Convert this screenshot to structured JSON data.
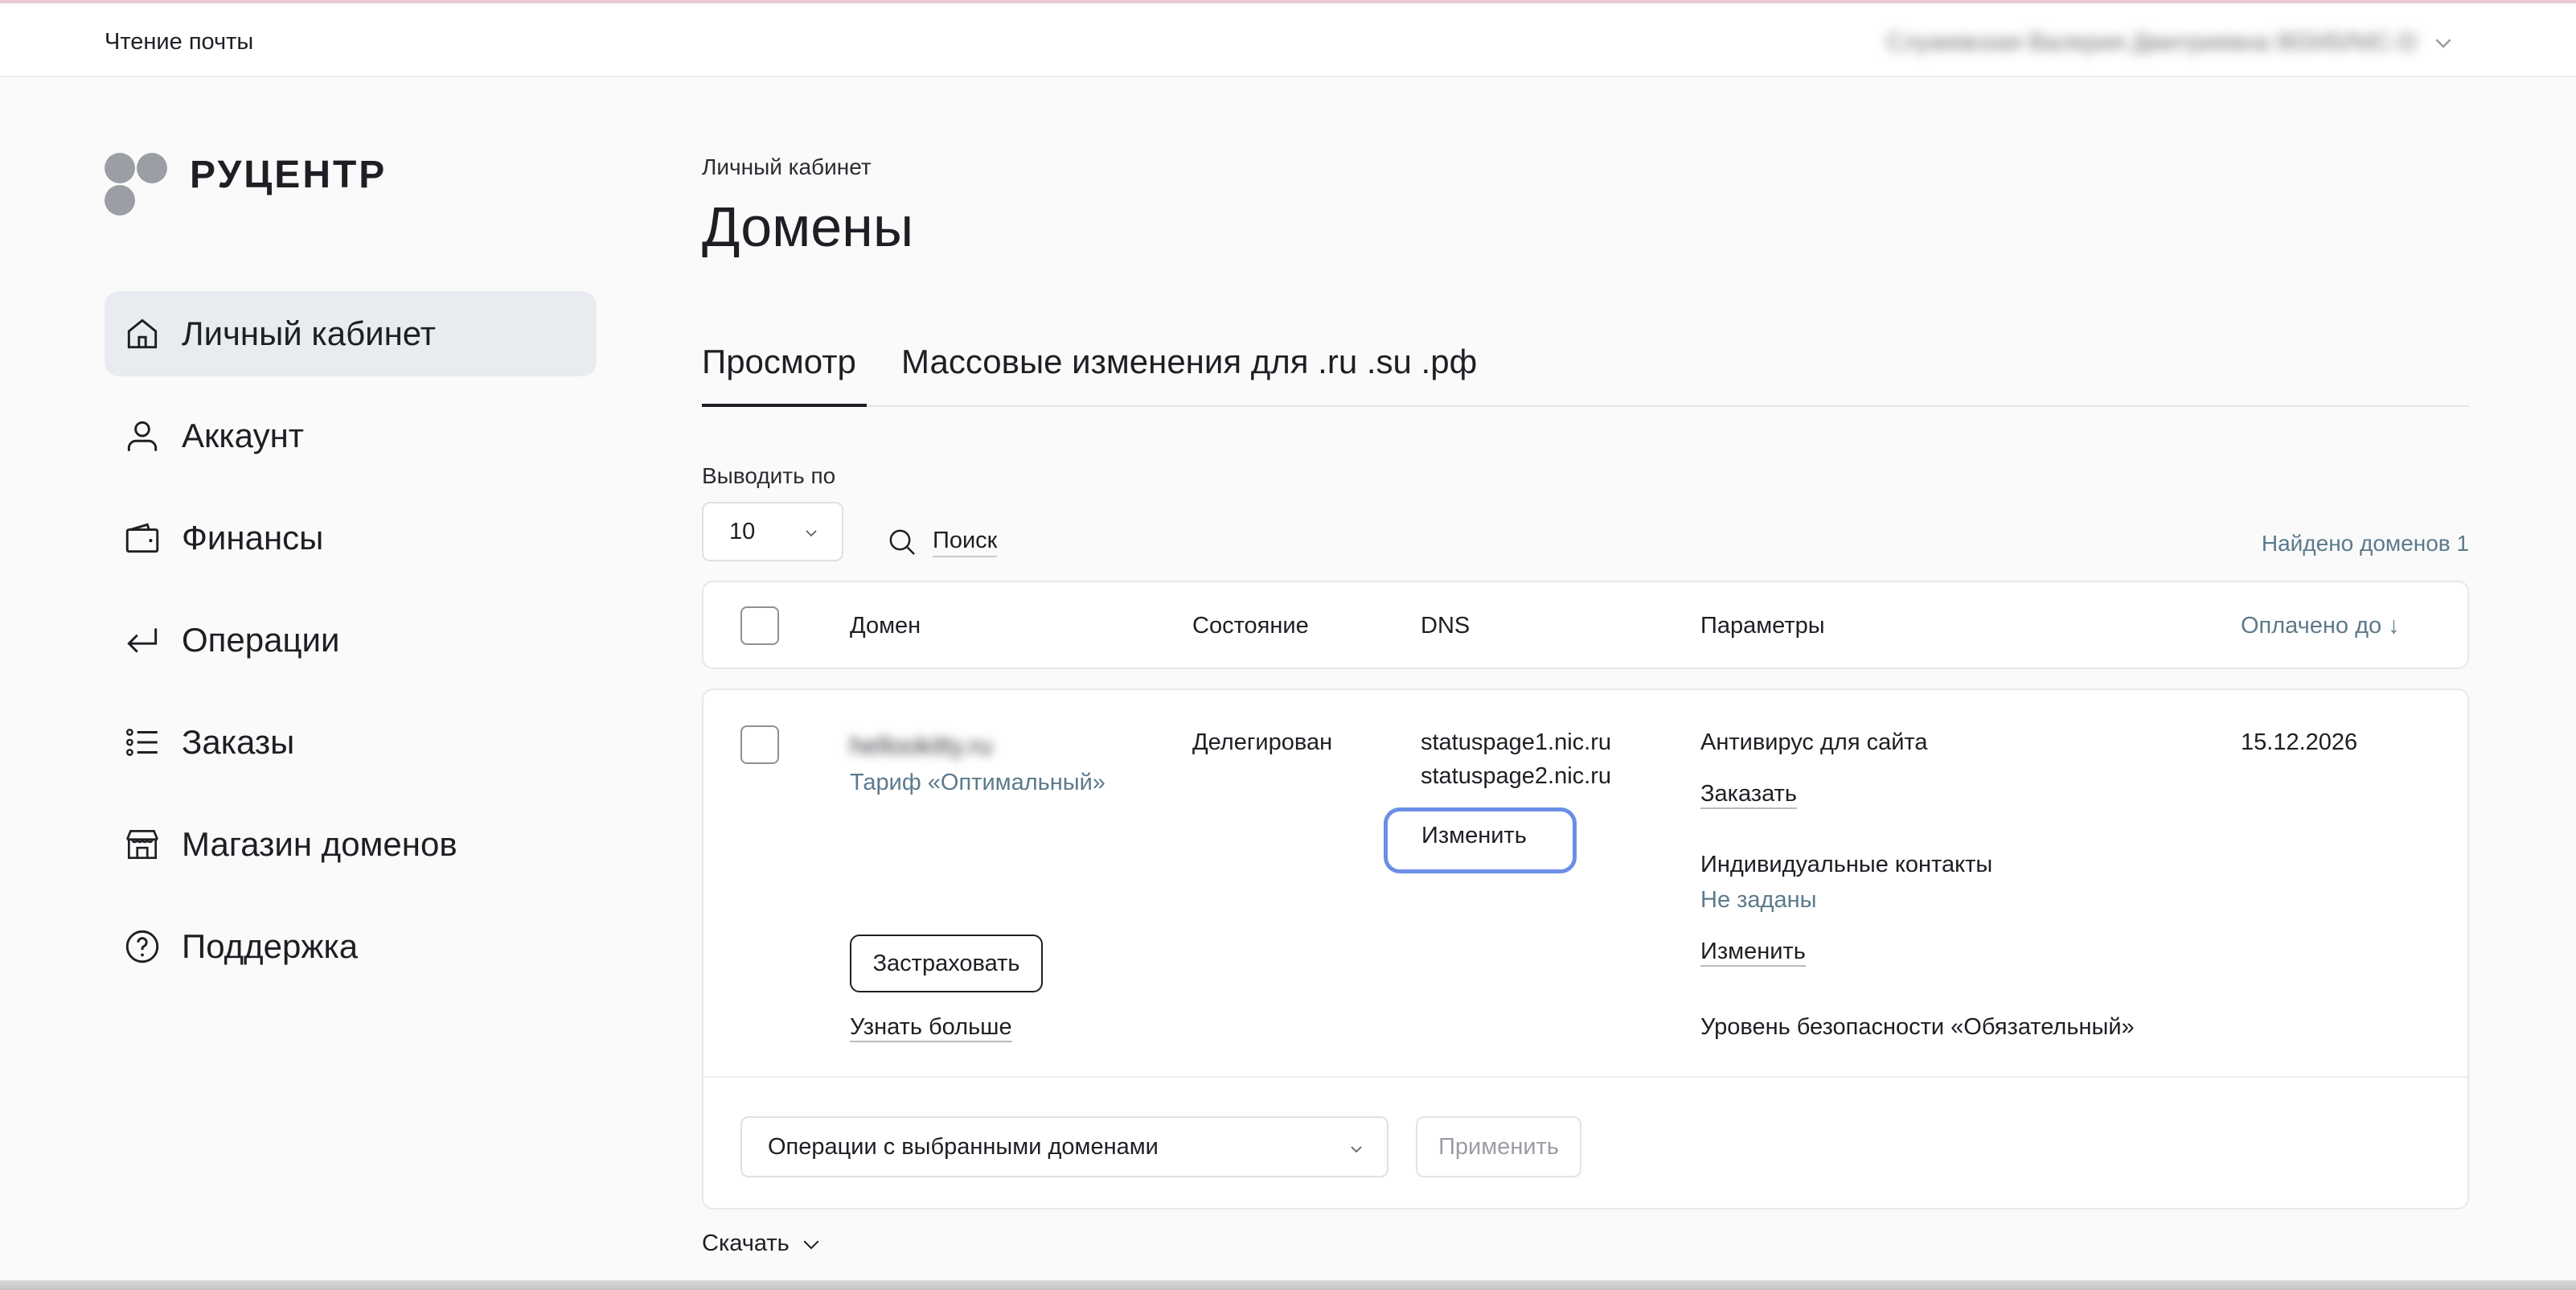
{
  "topbar": {
    "mail_label": "Чтение почты",
    "user_name": "Служевская Валерия Дмитриевна 90345/NIC-D"
  },
  "logo": {
    "name": "РУЦЕНТР"
  },
  "sidebar": {
    "items": [
      {
        "label": "Личный кабинет",
        "icon": "home-icon",
        "active": true
      },
      {
        "label": "Аккаунт",
        "icon": "user-icon"
      },
      {
        "label": "Финансы",
        "icon": "wallet-icon"
      },
      {
        "label": "Операции",
        "icon": "return-arrow-icon"
      },
      {
        "label": "Заказы",
        "icon": "list-icon"
      },
      {
        "label": "Магазин доменов",
        "icon": "store-icon"
      },
      {
        "label": "Поддержка",
        "icon": "question-icon"
      }
    ]
  },
  "main": {
    "breadcrumb": "Личный кабинет",
    "title": "Домены",
    "tabs": [
      {
        "label": "Просмотр",
        "active": true
      },
      {
        "label": "Массовые изменения для .ru .su .рф"
      }
    ],
    "per_page_label": "Выводить по",
    "per_page_value": "10",
    "search_label": "Поиск",
    "found_text": "Найдено доменов 1"
  },
  "table": {
    "headers": {
      "domain": "Домен",
      "state": "Состояние",
      "dns": "DNS",
      "params": "Параметры",
      "paid_until": "Оплачено до ↓"
    },
    "row": {
      "domain": "hellookitty.ru",
      "tariff": "Тариф «Оптимальный»",
      "state": "Делегирован",
      "dns_servers": [
        "statuspage1.nic.ru",
        "statuspage2.nic.ru"
      ],
      "dns_edit": "Изменить",
      "insure_button": "Застраховать",
      "learn_more": "Узнать больше",
      "antivirus_title": "Антивирус для сайта",
      "antivirus_order": "Заказать",
      "contacts_title": "Индивидуальные контакты",
      "contacts_value": "Не заданы",
      "contacts_edit": "Изменить",
      "security_level": "Уровень безопасности «Обязательный»",
      "paid_until": "15.12.2026"
    },
    "operations_select": "Операции с выбранными доменами",
    "apply_button": "Применить"
  },
  "footer": {
    "download_label": "Скачать"
  },
  "colors": {
    "highlight": "#6b8ee6",
    "active_nav": "#e8ebf0",
    "muted_text": "#5b7a8c"
  }
}
